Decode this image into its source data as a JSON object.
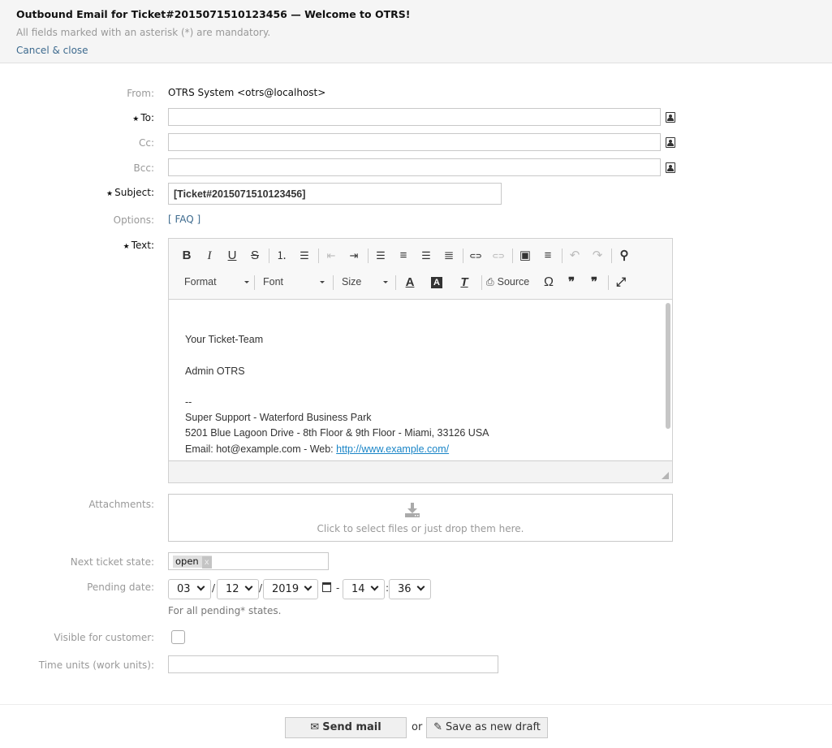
{
  "header": {
    "title": "Outbound Email for Ticket#2015071510123456 — Welcome to OTRS!",
    "subtitle": "All fields marked with an asterisk (*) are mandatory.",
    "cancel_label": "Cancel & close"
  },
  "form": {
    "from_label": "From:",
    "from_value": "OTRS System <otrs@localhost>",
    "to_label": "To:",
    "to_value": "",
    "cc_label": "Cc:",
    "cc_value": "",
    "bcc_label": "Bcc:",
    "bcc_value": "",
    "subject_label": "Subject:",
    "subject_value": "[Ticket#2015071510123456]",
    "options_label": "Options:",
    "options_link": "[ FAQ ]",
    "text_label": "Text:",
    "required_star": "★",
    "attachments_label": "Attachments:",
    "attachments_hint": "Click to select files or just drop them here.",
    "next_state_label": "Next ticket state:",
    "next_state_value": "open",
    "next_state_remove": "x",
    "pending_label": "Pending date:",
    "pending": {
      "month": "03",
      "day": "12",
      "year": "2019",
      "hour": "14",
      "minute": "36",
      "sep_slash": "/",
      "sep_dash": "-",
      "sep_colon": ":"
    },
    "pending_hint": "For all pending* states.",
    "visible_label": "Visible for customer:",
    "visible_checked": false,
    "time_units_label": "Time units (work units):",
    "time_units_value": ""
  },
  "editor": {
    "toolbar_row1": [
      {
        "name": "bold-icon",
        "glyph": "B",
        "disabled": false
      },
      {
        "name": "italic-icon",
        "glyph": "I",
        "disabled": false
      },
      {
        "name": "underline-icon",
        "glyph": "U",
        "disabled": false
      },
      {
        "name": "strikethrough-icon",
        "glyph": "S",
        "disabled": false
      },
      {
        "name": "numbered-list-icon",
        "glyph": "⒈",
        "disabled": false
      },
      {
        "name": "bulleted-list-icon",
        "glyph": "☰",
        "disabled": false
      },
      {
        "name": "outdent-icon",
        "glyph": "⇤",
        "disabled": true
      },
      {
        "name": "indent-icon",
        "glyph": "⇥",
        "disabled": false
      },
      {
        "name": "align-left-icon",
        "glyph": "☰",
        "disabled": false
      },
      {
        "name": "align-center-icon",
        "glyph": "≡",
        "disabled": false
      },
      {
        "name": "align-right-icon",
        "glyph": "☰",
        "disabled": false
      },
      {
        "name": "justify-icon",
        "glyph": "≣",
        "disabled": false
      },
      {
        "name": "link-icon",
        "glyph": "⊂⊃",
        "disabled": false
      },
      {
        "name": "unlink-icon",
        "glyph": "⊂⊃",
        "disabled": true
      },
      {
        "name": "image-icon",
        "glyph": "▣",
        "disabled": false
      },
      {
        "name": "horizontal-line-icon",
        "glyph": "≡",
        "disabled": false
      },
      {
        "name": "undo-icon",
        "glyph": "↶",
        "disabled": true
      },
      {
        "name": "redo-icon",
        "glyph": "↷",
        "disabled": true
      },
      {
        "name": "find-icon",
        "glyph": "⚲",
        "disabled": false
      }
    ],
    "format_label": "Format",
    "font_label": "Font",
    "size_label": "Size",
    "source_label": "Source",
    "toolbar_row2_icons": {
      "text_color": "A",
      "bg_color": "A",
      "remove_format": "T",
      "source": "⎙",
      "special_char": "Ω",
      "blockquote": "❞",
      "remove_quote": "❞",
      "maximize": "⤢"
    },
    "body_lines": [
      "Your Ticket-Team",
      "Admin OTRS",
      "--",
      "Super Support - Waterford Business Park",
      "5201 Blue Lagoon Drive - 8th Floor & 9th Floor - Miami, 33126 USA"
    ],
    "email_line_prefix": "Email: hot@example.com - Web: ",
    "email_line_link": "http://www.example.com/"
  },
  "footer": {
    "send_label": "Send mail",
    "or_label": "or",
    "draft_label": "Save as new draft",
    "send_icon": "✉",
    "draft_icon": "✎"
  }
}
